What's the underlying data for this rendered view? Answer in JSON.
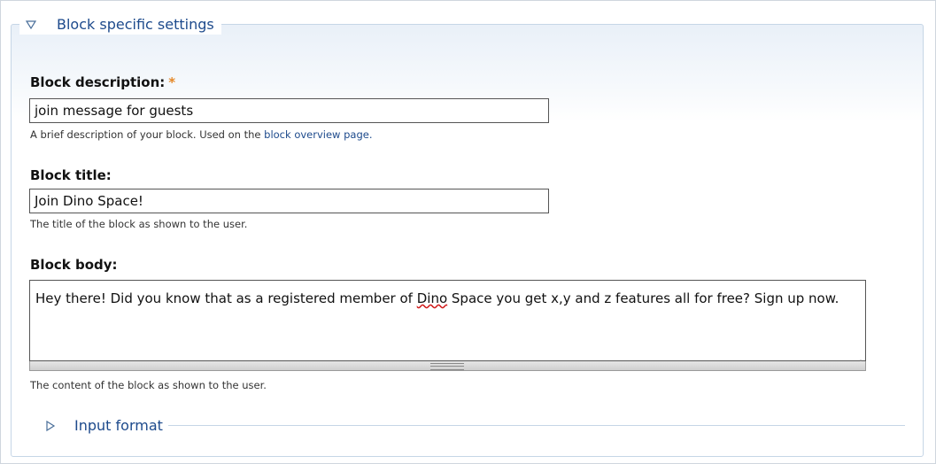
{
  "fieldset": {
    "legend": "Block specific settings",
    "toggle_icon": "triangle-down-icon"
  },
  "block_description": {
    "label": "Block description:",
    "required_marker": "*",
    "value": "join message for guests",
    "help_prefix": "A brief description of your block. Used on the ",
    "help_link": "block overview page.",
    "help_suffix": ""
  },
  "block_title": {
    "label": "Block title:",
    "value": "Join Dino Space!",
    "help": "The title of the block as shown to the user."
  },
  "block_body": {
    "label": "Block body:",
    "text_before": "Hey there! Did you know that as a registered member of ",
    "misspelled": "Dino",
    "text_after": " Space you get x,y and z features all for free? Sign up now.",
    "help": "The content of the block as shown to the user."
  },
  "input_format": {
    "legend": "Input format",
    "toggle_icon": "triangle-right-icon"
  },
  "colors": {
    "link": "#1d4a8c",
    "required": "#e5892a",
    "border": "#c6d6e6"
  }
}
